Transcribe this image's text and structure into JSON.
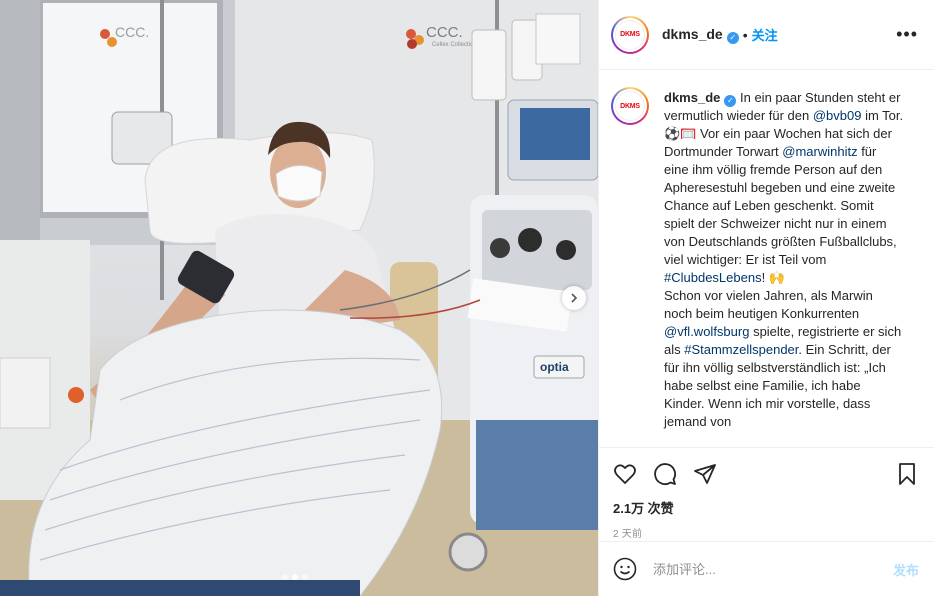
{
  "photo": {
    "wall_logo_text": "CCC.",
    "wall_logo_sub": "Cellex Collection",
    "machine_brand": "optia",
    "slides_count": 3,
    "active_slide": 2
  },
  "header": {
    "username": "dkms_de",
    "avatar_text": "DKMS",
    "separator": "•",
    "follow_label": "关注",
    "more_label": "•••"
  },
  "caption": {
    "username": "dkms_de",
    "parts": [
      {
        "t": "In ein paar Stunden steht er vermutlich wieder für den "
      },
      {
        "t": "@bvb09",
        "link": true
      },
      {
        "t": " im Tor. ⚽🥅 Vor ein paar Wochen hat sich der Dortmunder Torwart "
      },
      {
        "t": "@marwinhitz",
        "link": true
      },
      {
        "t": " für eine ihm völlig fremde Person auf den Apheresestuhl begeben und eine zweite Chance auf Leben geschenkt. Somit spielt der Schweizer nicht nur in einem von Deutschlands größten Fußballclubs, viel wichtiger: Er ist Teil vom "
      },
      {
        "t": "#ClubdesLebens",
        "link": true
      },
      {
        "t": "! 🙌"
      },
      {
        "br": true
      },
      {
        "t": "Schon vor vielen Jahren, als Marwin noch beim heutigen Konkurrenten "
      },
      {
        "t": "@vfl.wolfsburg",
        "link": true
      },
      {
        "t": " spielte, registrierte er sich als "
      },
      {
        "t": "#Stammzellspender",
        "link": true
      },
      {
        "t": ". Ein Schritt, der für ihn völlig selbstverständlich ist: „Ich habe selbst eine Familie, ich habe Kinder. Wenn ich mir vorstelle, dass jemand von"
      }
    ]
  },
  "actions": {
    "like_icon": "heart-icon",
    "comment_icon": "comment-icon",
    "share_icon": "paper-plane-icon",
    "save_icon": "bookmark-icon",
    "likes_text": "2.1万 次赞",
    "time_text": "2 天前"
  },
  "comment": {
    "emoji_icon": "smiley-icon",
    "placeholder": "添加评论...",
    "post_label": "发布"
  },
  "colors": {
    "link": "#00376b",
    "follow": "#0095f6",
    "post_disabled": "#b2dffc",
    "verified": "#3897f0",
    "brand_red": "#e30613"
  }
}
